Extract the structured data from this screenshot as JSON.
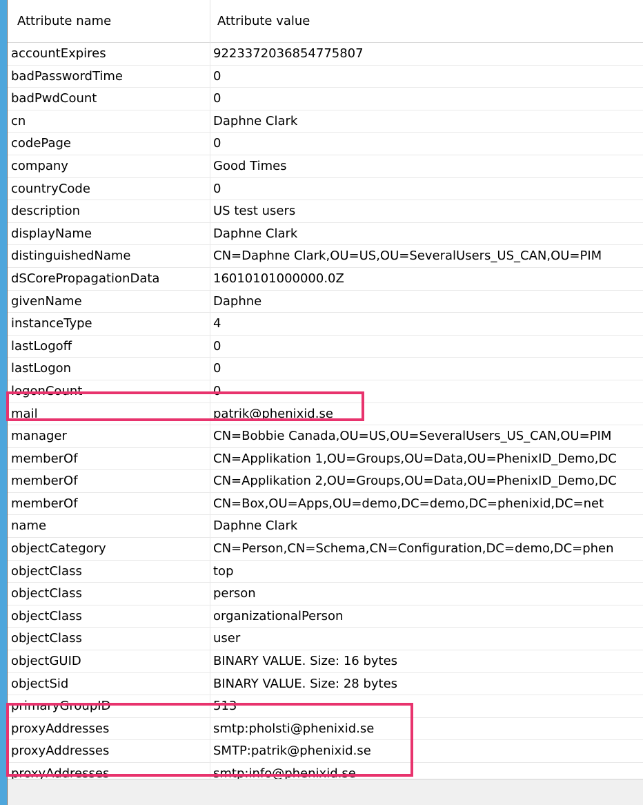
{
  "table": {
    "headers": {
      "name": "Attribute name",
      "value": "Attribute value"
    },
    "rows": [
      {
        "name": "accountExpires",
        "value": "9223372036854775807"
      },
      {
        "name": "badPasswordTime",
        "value": "0"
      },
      {
        "name": "badPwdCount",
        "value": "0"
      },
      {
        "name": "cn",
        "value": "Daphne Clark"
      },
      {
        "name": "codePage",
        "value": "0"
      },
      {
        "name": "company",
        "value": "Good Times"
      },
      {
        "name": "countryCode",
        "value": "0"
      },
      {
        "name": "description",
        "value": "US test users"
      },
      {
        "name": "displayName",
        "value": "Daphne Clark"
      },
      {
        "name": "distinguishedName",
        "value": "CN=Daphne Clark,OU=US,OU=SeveralUsers_US_CAN,OU=PIM"
      },
      {
        "name": "dSCorePropagationData",
        "value": "16010101000000.0Z"
      },
      {
        "name": "givenName",
        "value": "Daphne"
      },
      {
        "name": "instanceType",
        "value": "4"
      },
      {
        "name": "lastLogoff",
        "value": "0"
      },
      {
        "name": "lastLogon",
        "value": "0"
      },
      {
        "name": "logonCount",
        "value": "0"
      },
      {
        "name": "mail",
        "value": "patrik@phenixid.se"
      },
      {
        "name": "manager",
        "value": "CN=Bobbie Canada,OU=US,OU=SeveralUsers_US_CAN,OU=PIM"
      },
      {
        "name": "memberOf",
        "value": "CN=Applikation 1,OU=Groups,OU=Data,OU=PhenixID_Demo,DC"
      },
      {
        "name": "memberOf",
        "value": "CN=Applikation 2,OU=Groups,OU=Data,OU=PhenixID_Demo,DC"
      },
      {
        "name": "memberOf",
        "value": "CN=Box,OU=Apps,OU=demo,DC=demo,DC=phenixid,DC=net"
      },
      {
        "name": "name",
        "value": "Daphne Clark"
      },
      {
        "name": "objectCategory",
        "value": "CN=Person,CN=Schema,CN=Configuration,DC=demo,DC=phen"
      },
      {
        "name": "objectClass",
        "value": "top"
      },
      {
        "name": "objectClass",
        "value": "person"
      },
      {
        "name": "objectClass",
        "value": "organizationalPerson"
      },
      {
        "name": "objectClass",
        "value": "user"
      },
      {
        "name": "objectGUID",
        "value": "BINARY VALUE. Size: 16 bytes"
      },
      {
        "name": "objectSid",
        "value": "BINARY VALUE. Size: 28 bytes"
      },
      {
        "name": "primaryGroupID",
        "value": "513"
      },
      {
        "name": "proxyAddresses",
        "value": "smtp:pholsti@phenixid.se"
      },
      {
        "name": "proxyAddresses",
        "value": "SMTP:patrik@phenixid.se"
      },
      {
        "name": "proxyAddresses",
        "value": "smtp:info@phenixid.se"
      }
    ]
  },
  "colors": {
    "highlight": "#e8336d",
    "left_strip": "#4ea6dc"
  }
}
